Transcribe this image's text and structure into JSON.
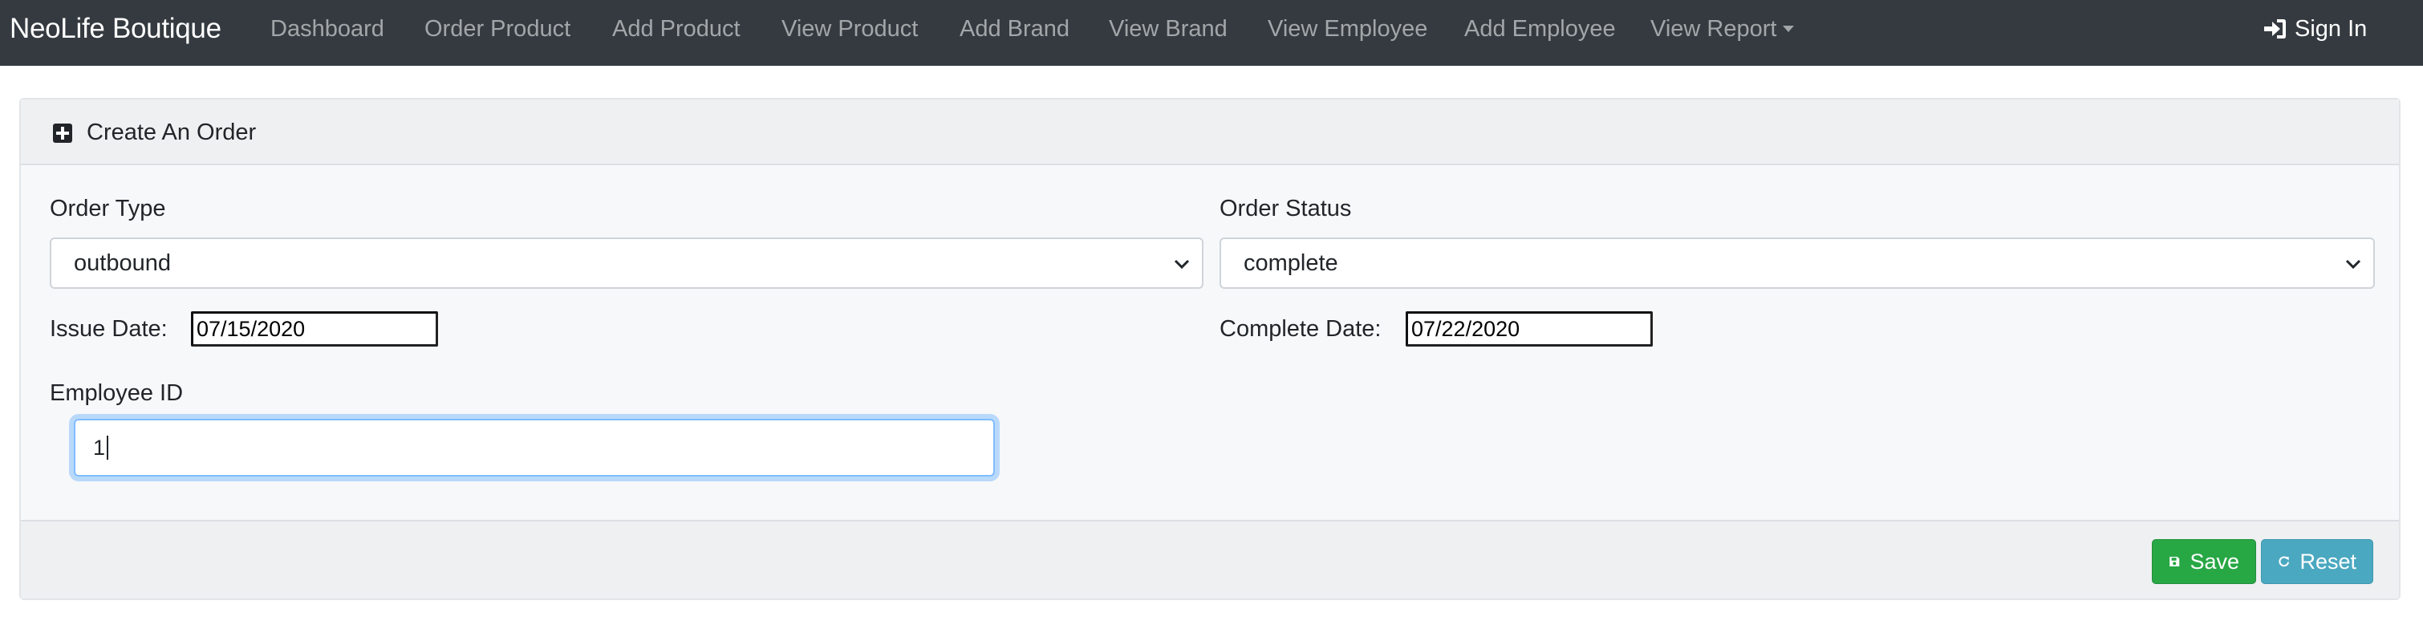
{
  "navbar": {
    "brand": "NeoLife Boutique",
    "links": [
      {
        "label": "Dashboard"
      },
      {
        "label": "Order Product"
      },
      {
        "label": "Add Product"
      },
      {
        "label": "View Product"
      },
      {
        "label": "Add Brand"
      },
      {
        "label": "View Brand"
      },
      {
        "label": "View Employee"
      },
      {
        "label": "Add Employee"
      },
      {
        "label": "View Report"
      }
    ],
    "signin": "Sign In",
    "signin_icon": "sign-in-icon",
    "background_color": "#343a40"
  },
  "card": {
    "title": "Create An Order",
    "title_icon": "plus-square-icon",
    "order_type": {
      "label": "Order Type",
      "value": "outbound"
    },
    "order_status": {
      "label": "Order Status",
      "value": "complete"
    },
    "issue_date": {
      "label": "Issue Date:",
      "value": "07/15/2020"
    },
    "complete_date": {
      "label": "Complete Date:",
      "value": "07/22/2020"
    },
    "employee_id": {
      "label": "Employee ID",
      "value": "1"
    }
  },
  "footer": {
    "save": {
      "label": "Save",
      "icon": "save-icon",
      "color": "#28a745"
    },
    "reset": {
      "label": "Reset",
      "icon": "reset-icon",
      "color": "#4aa8c0"
    }
  }
}
